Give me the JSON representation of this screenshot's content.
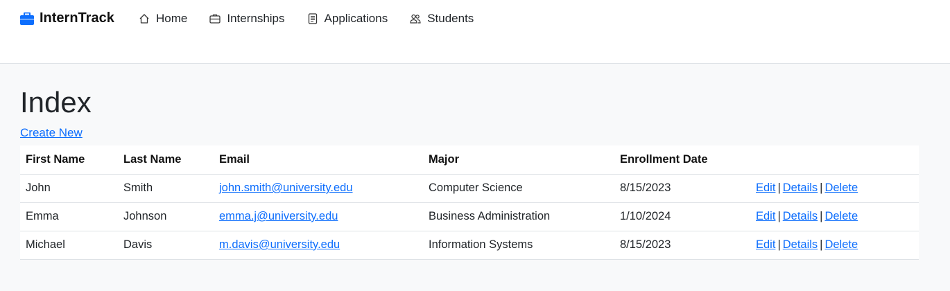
{
  "nav": {
    "brand": "InternTrack",
    "items": [
      {
        "label": "Home",
        "icon": "home-icon"
      },
      {
        "label": "Internships",
        "icon": "briefcase-icon"
      },
      {
        "label": "Applications",
        "icon": "document-icon"
      },
      {
        "label": "Students",
        "icon": "people-icon"
      }
    ]
  },
  "page": {
    "title": "Index",
    "create_label": "Create New"
  },
  "table": {
    "headers": [
      "First Name",
      "Last Name",
      "Email",
      "Major",
      "Enrollment Date",
      ""
    ],
    "rows": [
      {
        "first": "John",
        "last": "Smith",
        "email": "john.smith@university.edu",
        "major": "Computer Science",
        "date": "8/15/2023"
      },
      {
        "first": "Emma",
        "last": "Johnson",
        "email": "emma.j@university.edu",
        "major": "Business Administration",
        "date": "1/10/2024"
      },
      {
        "first": "Michael",
        "last": "Davis",
        "email": "m.davis@university.edu",
        "major": "Information Systems",
        "date": "8/15/2023"
      }
    ],
    "actions": {
      "edit": "Edit",
      "details": "Details",
      "delete": "Delete",
      "separator": "|"
    }
  },
  "colors": {
    "brand_icon": "#0d6efd",
    "link": "#0d6efd",
    "background": "#f8f9fa"
  }
}
